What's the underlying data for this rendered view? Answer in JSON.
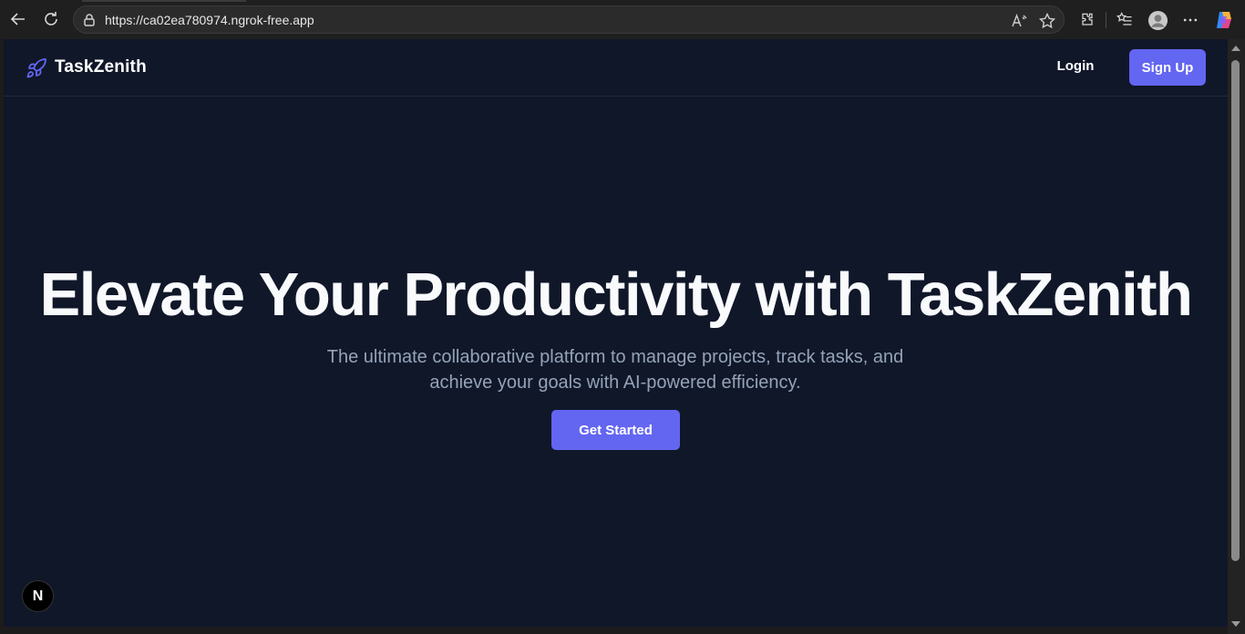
{
  "browser": {
    "url": "https://ca02ea780974.ngrok-free.app",
    "icons": [
      "back-arrow-icon",
      "refresh-icon",
      "lock-icon",
      "read-aloud-icon",
      "favorite-star-icon",
      "extensions-icon",
      "favorites-list-icon",
      "profile-avatar-icon",
      "more-options-icon",
      "copilot-icon"
    ]
  },
  "header": {
    "brand": "TaskZenith",
    "login_label": "Login",
    "signup_label": "Sign Up"
  },
  "hero": {
    "title": "Elevate Your Productivity with TaskZenith",
    "subtitle": "The ultimate collaborative platform to manage projects, track tasks, and achieve your goals with AI-powered efficiency.",
    "cta_label": "Get Started"
  },
  "dev_badge": {
    "label": "N"
  },
  "colors": {
    "page_bg": "#101729",
    "accent": "#6366f1",
    "title": "#f8fafc",
    "subtitle": "#94a3b8"
  }
}
